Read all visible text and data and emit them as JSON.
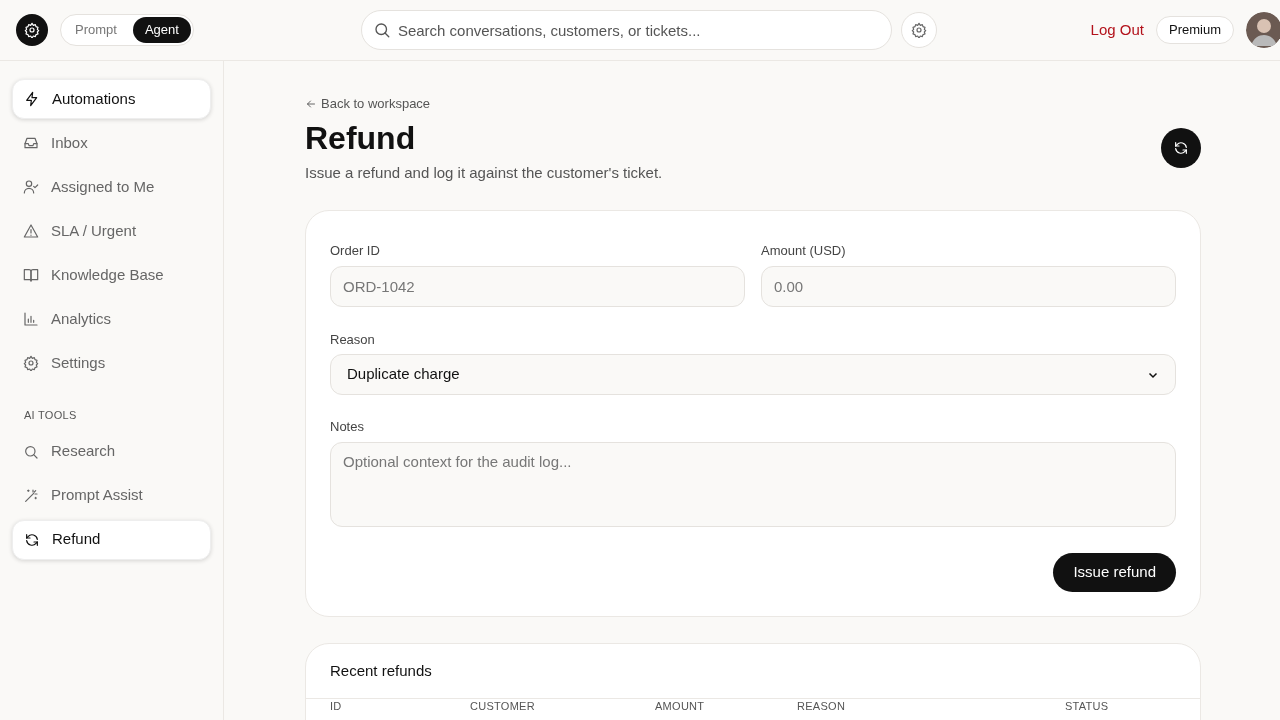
{
  "header": {
    "mode_tabs": [
      {
        "label": "Prompt",
        "selected": false
      },
      {
        "label": "Agent",
        "selected": true
      }
    ],
    "search": {
      "placeholder": "Search conversations, customers, or tickets..."
    },
    "logout": "Log Out",
    "plan_badge": "Premium"
  },
  "sidebar": {
    "items": [
      {
        "label": "Automations",
        "selected": true
      },
      {
        "label": "Inbox",
        "selected": false
      },
      {
        "label": "Assigned to Me",
        "selected": false
      },
      {
        "label": "SLA / Urgent",
        "selected": false
      },
      {
        "label": "Knowledge Base",
        "selected": false
      },
      {
        "label": "Analytics",
        "selected": false
      },
      {
        "label": "Settings",
        "selected": false
      }
    ],
    "section_title": "AI TOOLS",
    "tool_items": [
      {
        "label": "Research",
        "selected": false
      },
      {
        "label": "Prompt Assist",
        "selected": false
      },
      {
        "label": "Refund",
        "selected": true
      }
    ]
  },
  "page": {
    "back_link": "Back to workspace",
    "title": "Refund",
    "subtitle": "Issue a refund and log it against the customer's ticket.",
    "form": {
      "order_id": {
        "label": "Order ID",
        "placeholder": "ORD-1042"
      },
      "amount": {
        "label": "Amount (USD)",
        "placeholder": "0.00"
      },
      "reason": {
        "label": "Reason",
        "value": "Duplicate charge"
      },
      "notes": {
        "label": "Notes",
        "placeholder": "Optional context for the audit log..."
      },
      "submit": "Issue refund"
    },
    "recent": {
      "title": "Recent refunds",
      "columns": [
        "ID",
        "CUSTOMER",
        "AMOUNT",
        "REASON",
        "STATUS"
      ]
    }
  }
}
